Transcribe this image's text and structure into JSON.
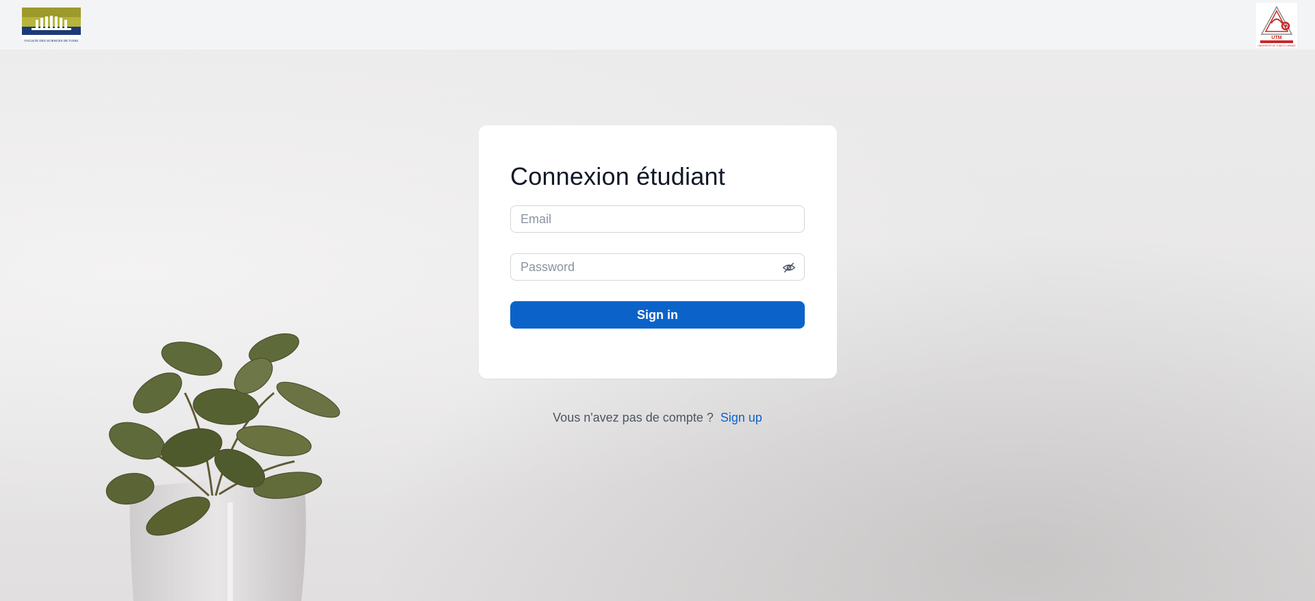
{
  "header": {
    "left_logo_caption": "FACULTE DES SCIENCES DE TUNIS",
    "right_logo_caption": "UNIVERSITE DE TUNIS EL MANAR",
    "right_logo_letters": "UTM"
  },
  "login": {
    "title": "Connexion étudiant",
    "email_placeholder": "Email",
    "email_value": "",
    "password_placeholder": "Password",
    "password_value": "",
    "signin_label": "Sign in"
  },
  "footer": {
    "prompt": "Vous n'avez pas de compte ?",
    "signup_label": "Sign up"
  },
  "icons": {
    "password_toggle": "eye-off-icon"
  },
  "colors": {
    "primary": "#0b63c9",
    "topbar_bg": "#f3f4f6",
    "page_bg": "#e8e7e7",
    "card_bg": "#ffffff"
  }
}
